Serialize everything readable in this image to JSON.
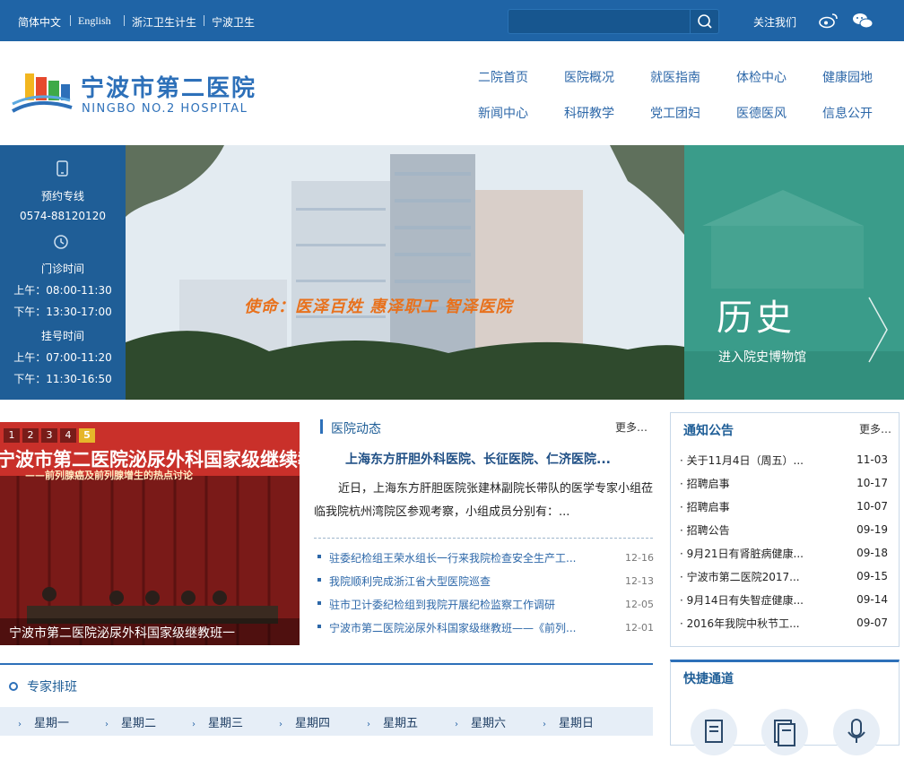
{
  "topbar": {
    "links": [
      "简体中文",
      "English",
      "浙江卫生计生",
      "宁波卫生"
    ],
    "search_placeholder": "",
    "follow_label": "关注我们"
  },
  "header": {
    "logo_name": "宁波市第二医院",
    "logo_en": "NINGBO NO.2 HOSPITAL",
    "nav_row1": [
      "二院首页",
      "医院概况",
      "就医指南",
      "体检中心",
      "健康园地"
    ],
    "nav_row2": [
      "新闻中心",
      "科研教学",
      "党工团妇",
      "医德医风",
      "信息公开"
    ]
  },
  "banner": {
    "info": {
      "booking_label": "预约专线",
      "booking_phone": "0574-88120120",
      "clinic_label": "门诊时间",
      "clinic_am": "上午：08:00-11:30",
      "clinic_pm": "下午：13:30-17:00",
      "register_label": "挂号时间",
      "register_am": "上午：07:00-11:20",
      "register_pm": "下午：11:30-16:50"
    },
    "slogan": "使命：医泽百姓  惠泽职工  智泽医院",
    "history_title": "历史",
    "history_sub": "进入院史博物馆"
  },
  "slideshow": {
    "pages": [
      "1",
      "2",
      "3",
      "4",
      "5"
    ],
    "active_page": "5",
    "caption": "宁波市第二医院泌尿外科国家级继教班一",
    "photo_text": "宁波市第二医院泌尿外科国家级继续教",
    "photo_subtext": "——前列腺癌及前列腺增生的热点讨论"
  },
  "news": {
    "title": "医院动态",
    "more": "更多…",
    "headline": "上海东方肝胆外科医院、长征医院、仁济医院...",
    "summary_line1": "近日，上海东方肝胆医院张建林副院长带队的医学专家小组莅",
    "summary_line2": "临我院杭州湾院区参观考察，小组成员分别有：...",
    "items": [
      {
        "text": "驻委纪检组王荣水组长一行来我院检查安全生产工...",
        "date": "12-16"
      },
      {
        "text": "我院顺利完成浙江省大型医院巡查",
        "date": "12-13"
      },
      {
        "text": "驻市卫计委纪检组到我院开展纪检监察工作调研",
        "date": "12-05"
      },
      {
        "text": "宁波市第二医院泌尿外科国家级继教班——《前列...",
        "date": "12-01"
      }
    ]
  },
  "notice": {
    "title": "通知公告",
    "more": "更多…",
    "items": [
      {
        "text": "· 关于11月4日（周五）...",
        "date": "11-03"
      },
      {
        "text": "· 招聘启事",
        "date": "10-17"
      },
      {
        "text": "· 招聘启事",
        "date": "10-07"
      },
      {
        "text": "· 招聘公告",
        "date": "09-19"
      },
      {
        "text": "· 9月21日有肾脏病健康...",
        "date": "09-18"
      },
      {
        "text": "· 宁波市第二医院2017...",
        "date": "09-15"
      },
      {
        "text": "· 9月14日有失智症健康...",
        "date": "09-14"
      },
      {
        "text": "· 2016年我院中秋节工...",
        "date": "09-07"
      }
    ]
  },
  "expert": {
    "title": "专家排班",
    "days": [
      "星期一",
      "星期二",
      "星期三",
      "星期四",
      "星期五",
      "星期六",
      "星期日"
    ]
  },
  "quick": {
    "title": "快捷通道"
  },
  "colors": {
    "primary": "#1f64a6",
    "panel": "#1f5e97",
    "history": "#3a9c8a",
    "slogan": "#e8711c"
  }
}
